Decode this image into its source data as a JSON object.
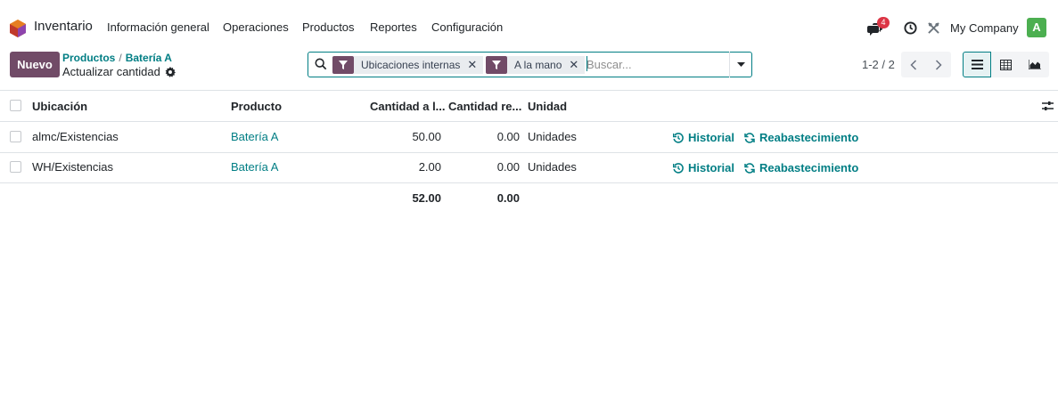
{
  "navbar": {
    "app_name": "Inventario",
    "menu": [
      "Información general",
      "Operaciones",
      "Productos",
      "Reportes",
      "Configuración"
    ],
    "chat_badge": "4",
    "company": "My Company",
    "avatar_letter": "A"
  },
  "control_panel": {
    "new_button": "Nuevo",
    "breadcrumb": [
      "Productos",
      "Batería A"
    ],
    "subtitle": "Actualizar cantidad",
    "search": {
      "facets": [
        "Ubicaciones internas",
        "A la mano"
      ],
      "placeholder": "Buscar..."
    },
    "pager": "1-2 / 2"
  },
  "table": {
    "columns": [
      "Ubicación",
      "Producto",
      "Cantidad a l...",
      "Cantidad re...",
      "Unidad"
    ],
    "rows": [
      {
        "location": "almc/Existencias",
        "product": "Batería A",
        "on_hand": "50.00",
        "reserved": "0.00",
        "unit": "Unidades",
        "history": "Historial",
        "replenish": "Reabastecimiento"
      },
      {
        "location": "WH/Existencias",
        "product": "Batería A",
        "on_hand": "2.00",
        "reserved": "0.00",
        "unit": "Unidades",
        "history": "Historial",
        "replenish": "Reabastecimiento"
      }
    ],
    "totals": {
      "on_hand": "52.00",
      "reserved": "0.00"
    }
  },
  "colors": {
    "brand": "#714b67",
    "link": "#017e84",
    "badge": "#dc3545",
    "avatar": "#4caf50"
  }
}
